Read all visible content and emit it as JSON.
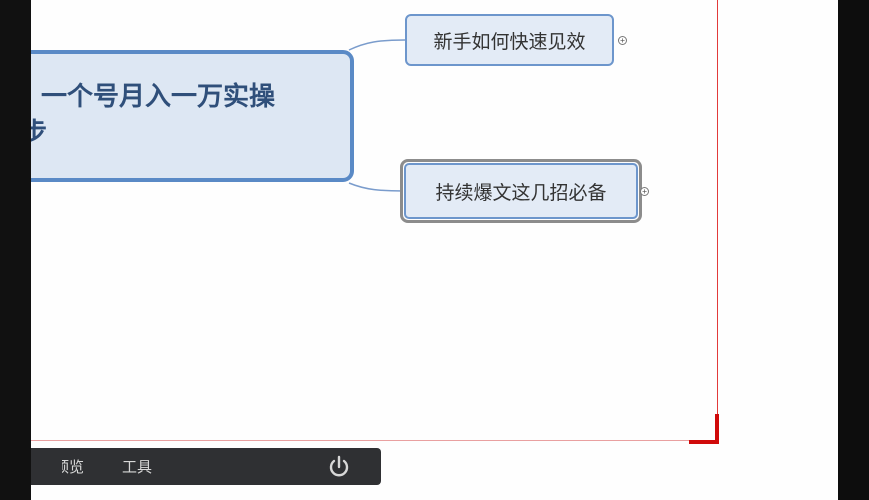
{
  "mindmap": {
    "central_topic": {
      "line1": "一个号月入一万实操",
      "line2": "步"
    },
    "subtopics": [
      {
        "label": "新手如何快速见效",
        "expander": "+"
      },
      {
        "label": "持续爆文这几招必备",
        "expander": "+"
      }
    ]
  },
  "toolbar": {
    "preview_label": "预览",
    "tools_label": "工具",
    "power_icon": "power-icon"
  },
  "colors": {
    "central_border": "#5a8ac6",
    "central_fill": "#dde7f3",
    "topic_border": "#6d96cc",
    "topic_fill": "#e3ebf6",
    "selection_border": "#8c8c8c",
    "page_boundary": "#e23a3a",
    "toolbar_bg": "#2f3033"
  }
}
